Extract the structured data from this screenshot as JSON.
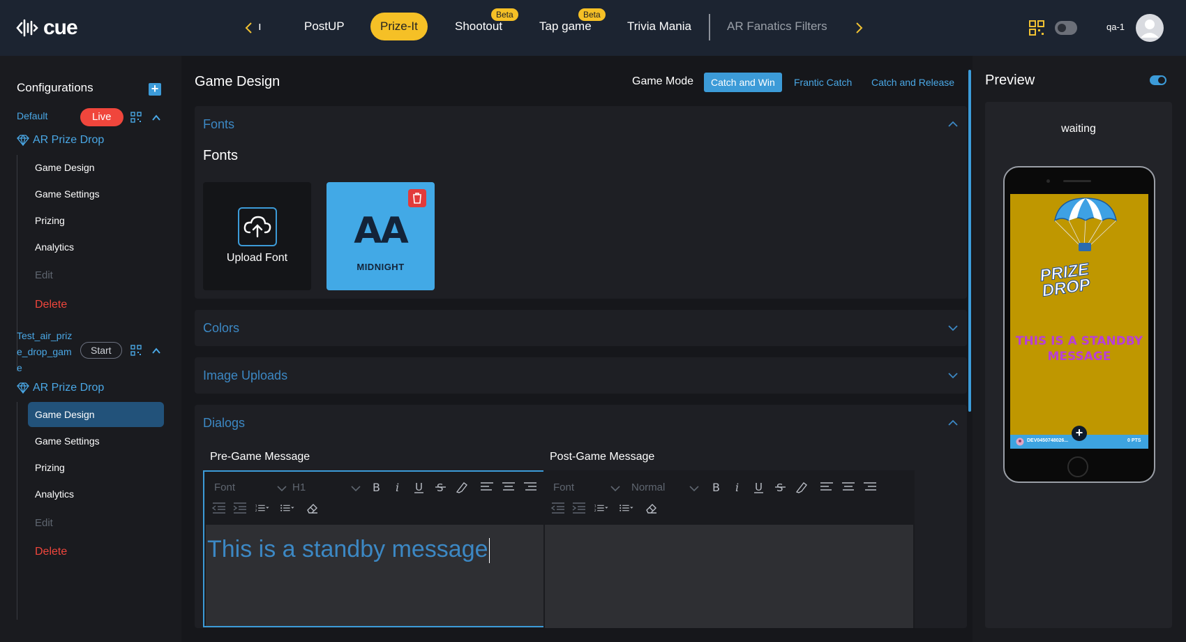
{
  "app": {
    "brand": "cue",
    "user": "qa-1"
  },
  "nav": {
    "items": [
      {
        "label": "PostUP"
      },
      {
        "label": "Prize-It"
      },
      {
        "label": "Shootout",
        "badge": "Beta"
      },
      {
        "label": "Tap game",
        "badge": "Beta"
      },
      {
        "label": "Trivia Mania"
      },
      {
        "label": "AR Fanatics Filters"
      }
    ],
    "partial": "ı"
  },
  "sidebar": {
    "title": "Configurations",
    "configs": [
      {
        "name": "Default",
        "status": "Live",
        "game_type": "AR Prize Drop",
        "items": [
          "Game Design",
          "Game Settings",
          "Prizing",
          "Analytics",
          "Edit",
          "Delete"
        ]
      },
      {
        "name_lines": [
          "Test_air_priz",
          "e_drop_gam",
          "e"
        ],
        "status": "Start",
        "game_type": "AR Prize Drop",
        "items": [
          "Game Design",
          "Game Settings",
          "Prizing",
          "Analytics",
          "Edit",
          "Delete"
        ]
      }
    ]
  },
  "main": {
    "title": "Game Design",
    "game_mode_label": "Game Mode",
    "game_modes": [
      "Catch and Win",
      "Frantic Catch",
      "Catch and Release"
    ],
    "panels": {
      "fonts": {
        "title": "Fonts",
        "subheading": "Fonts",
        "upload_label": "Upload Font",
        "font_preview": "AA",
        "font_name": "MIDNIGHT"
      },
      "colors": {
        "title": "Colors"
      },
      "images": {
        "title": "Image Uploads"
      },
      "dialogs": {
        "title": "Dialogs",
        "pre": {
          "label": "Pre-Game Message",
          "font_placeholder": "Font",
          "style": "H1",
          "content": "This is a standby message"
        },
        "post": {
          "label": "Post-Game Message",
          "font_placeholder": "Font",
          "style": "Normal",
          "content": ""
        }
      }
    }
  },
  "preview": {
    "title": "Preview",
    "status": "waiting",
    "phone": {
      "game_title_line1": "PRIZE",
      "game_title_line2": "DROP",
      "message_line1": "THIS IS A STANDBY",
      "message_line2": "MESSAGE",
      "footer_id": "DEV0450748026...",
      "footer_points": "0 PTS"
    }
  },
  "colors": {
    "accent": "#3c9bd8",
    "brand_yellow": "#f5c026",
    "danger": "#f0463c"
  }
}
